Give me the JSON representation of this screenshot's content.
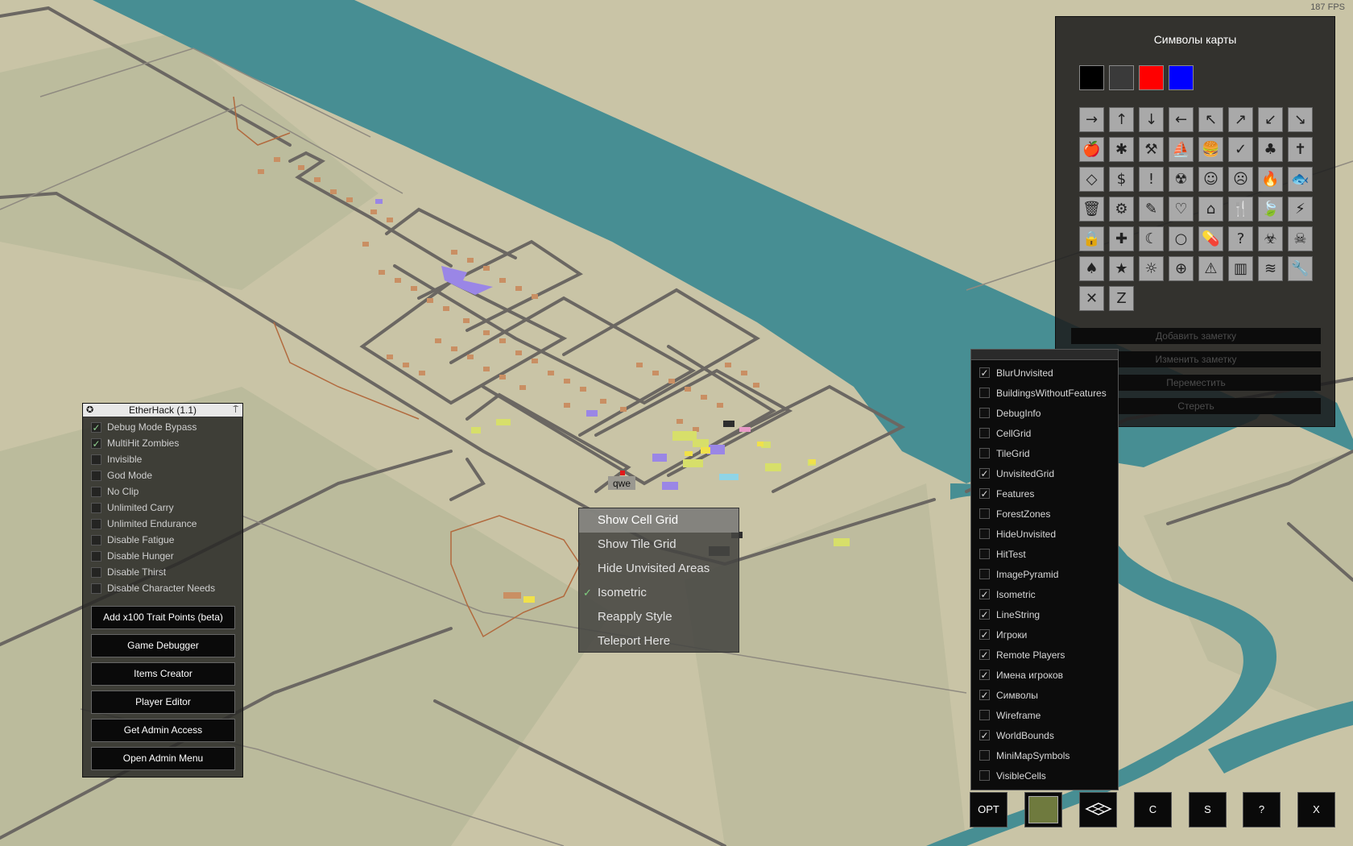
{
  "fps": "187 FPS",
  "map": {
    "player_label": "qwe",
    "colors": {
      "ground": "#c9c4a6",
      "forest": "#b3b596",
      "water": "#478e93",
      "road": "#6b6762",
      "building": "#c98f63",
      "purple": "#9a86e6",
      "yellow": "#e6e36b",
      "player_marker": "#e11a1a"
    }
  },
  "etherhack": {
    "title": "EtherHack (1.1)",
    "options": [
      {
        "label": "Debug Mode Bypass",
        "checked": true
      },
      {
        "label": "MultiHit Zombies",
        "checked": true
      },
      {
        "label": "Invisible",
        "checked": false
      },
      {
        "label": "God Mode",
        "checked": false
      },
      {
        "label": "No Clip",
        "checked": false
      },
      {
        "label": "Unlimited Carry",
        "checked": false
      },
      {
        "label": "Unlimited Endurance",
        "checked": false
      },
      {
        "label": "Disable Fatigue",
        "checked": false
      },
      {
        "label": "Disable Hunger",
        "checked": false
      },
      {
        "label": "Disable Thirst",
        "checked": false
      },
      {
        "label": "Disable Character Needs",
        "checked": false
      }
    ],
    "buttons": [
      "Add x100 Trait Points (beta)",
      "Game Debugger",
      "Items Creator",
      "Player Editor",
      "Get Admin Access",
      "Open Admin Menu"
    ]
  },
  "context_menu": {
    "items": [
      {
        "label": "Show Cell Grid",
        "highlighted": true,
        "checked": false
      },
      {
        "label": "Show Tile Grid",
        "highlighted": false,
        "checked": false
      },
      {
        "label": "Hide Unvisited Areas",
        "highlighted": false,
        "checked": false
      },
      {
        "label": "Isometric",
        "highlighted": false,
        "checked": true
      },
      {
        "label": "Reapply Style",
        "highlighted": false,
        "checked": false
      },
      {
        "label": "Teleport Here",
        "highlighted": false,
        "checked": false
      }
    ]
  },
  "symbols_panel": {
    "title": "Символы карты",
    "colors": [
      "#000000",
      "#3a3a3a",
      "#ff0000",
      "#0000ff"
    ],
    "symbols": [
      "→",
      "↑",
      "↓",
      "←",
      "↖",
      "↗",
      "↙",
      "↘",
      "🍎",
      "✱",
      "⚒",
      "⛵",
      "🍔",
      "✓",
      "♣",
      "✝",
      "◇",
      "$",
      "!",
      "☢",
      "☺",
      "☹",
      "🔥",
      "🐟",
      "🗑",
      "⚙",
      "✎",
      "♡",
      "⌂",
      "🍴",
      "🍃",
      "⚡",
      "🔒",
      "✚",
      "☾",
      "○",
      "💊",
      "?",
      "☣",
      "☠",
      "♠",
      "★",
      "☼",
      "⊕",
      "⚠",
      "▥",
      "≋",
      "🔧",
      "✕",
      "Z"
    ],
    "buttons": [
      "Добавить заметку",
      "Изменить заметку",
      "Переместить",
      "Стереть"
    ]
  },
  "layers": [
    {
      "label": "BlurUnvisited",
      "checked": true
    },
    {
      "label": "BuildingsWithoutFeatures",
      "checked": false
    },
    {
      "label": "DebugInfo",
      "checked": false
    },
    {
      "label": "CellGrid",
      "checked": false
    },
    {
      "label": "TileGrid",
      "checked": false
    },
    {
      "label": "UnvisitedGrid",
      "checked": true
    },
    {
      "label": "Features",
      "checked": true
    },
    {
      "label": "ForestZones",
      "checked": false
    },
    {
      "label": "HideUnvisited",
      "checked": false
    },
    {
      "label": "HitTest",
      "checked": false
    },
    {
      "label": "ImagePyramid",
      "checked": false
    },
    {
      "label": "Isometric",
      "checked": true
    },
    {
      "label": "LineString",
      "checked": true
    },
    {
      "label": "Игроки",
      "checked": true
    },
    {
      "label": "Remote Players",
      "checked": true
    },
    {
      "label": "Имена игроков",
      "checked": true
    },
    {
      "label": "Символы",
      "checked": true
    },
    {
      "label": "Wireframe",
      "checked": false
    },
    {
      "label": "WorldBounds",
      "checked": true
    },
    {
      "label": "MiniMapSymbols",
      "checked": false
    },
    {
      "label": "VisibleCells",
      "checked": false
    }
  ],
  "toolbar": {
    "opt": "OPT",
    "c": "C",
    "s": "S",
    "help": "?",
    "close": "X"
  }
}
